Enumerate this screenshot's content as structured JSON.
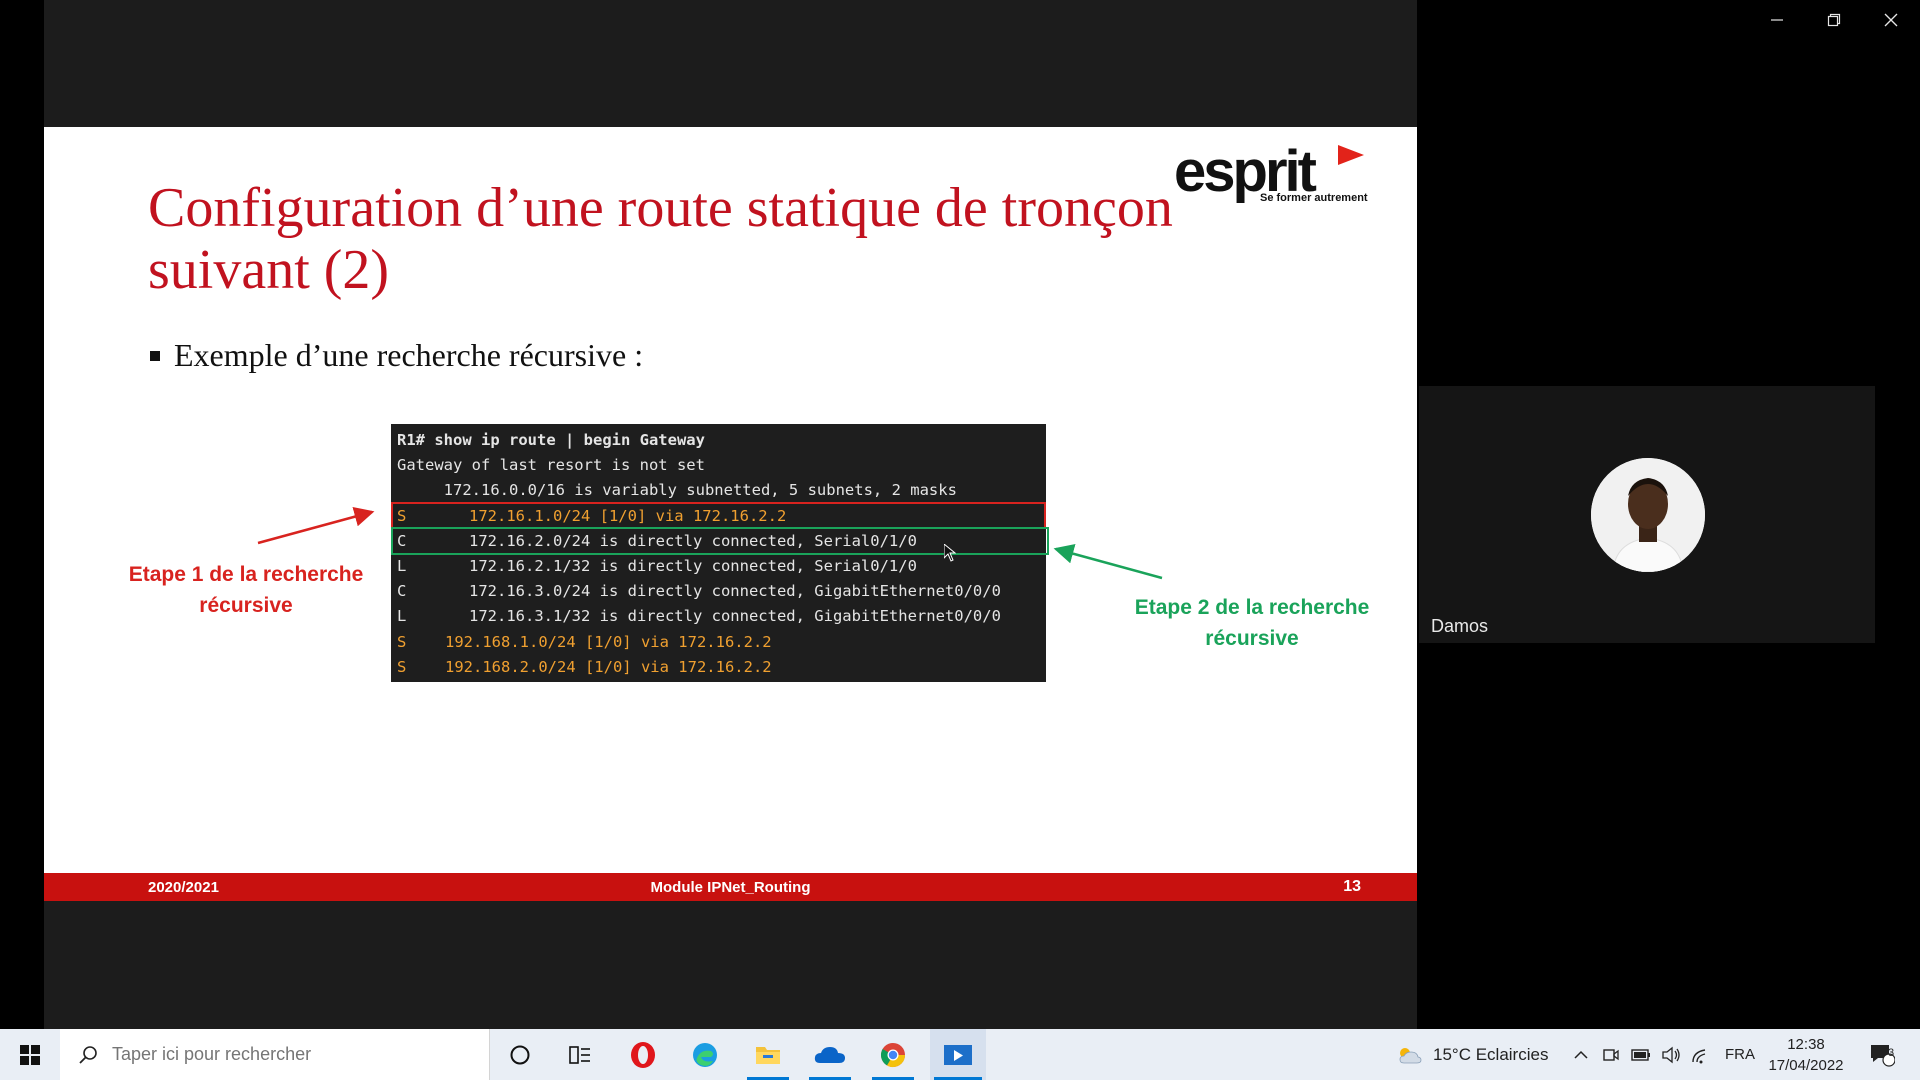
{
  "window": {
    "controls": [
      "minimize-icon",
      "restore-icon",
      "close-icon"
    ]
  },
  "slide": {
    "title_line1": "Configuration d’une route statique de tronçon",
    "title_line2": "suivant (2)",
    "logo_text": "esprit",
    "logo_tagline": "Se former autrement",
    "bullet": "Exemple d’une recherche récursive :",
    "terminal": {
      "prompt": "R1#",
      "command": "show ip route | begin Gateway",
      "lines": [
        {
          "code": "",
          "text": "Gateway of last resort is not set",
          "style": "normal",
          "indent": false
        },
        {
          "code": "",
          "text": "     172.16.0.0/16 is variably subnetted, 5 subnets, 2 masks",
          "style": "normal",
          "indent": false
        },
        {
          "code": "S",
          "text": "172.16.1.0/24 [1/0] via 172.16.2.2",
          "style": "static",
          "indent": true
        },
        {
          "code": "C",
          "text": "172.16.2.0/24 is directly connected, Serial0/1/0",
          "style": "normal",
          "indent": true
        },
        {
          "code": "L",
          "text": "172.16.2.1/32 is directly connected, Serial0/1/0",
          "style": "normal",
          "indent": true
        },
        {
          "code": "C",
          "text": "172.16.3.0/24 is directly connected, GigabitEthernet0/0/0",
          "style": "normal",
          "indent": true
        },
        {
          "code": "L",
          "text": "172.16.3.1/32 is directly connected, GigabitEthernet0/0/0",
          "style": "normal",
          "indent": true
        },
        {
          "code": "S",
          "text": "192.168.1.0/24 [1/0] via 172.16.2.2",
          "style": "static",
          "indent": false
        },
        {
          "code": "S",
          "text": "192.168.2.0/24 [1/0] via 172.16.2.2",
          "style": "static",
          "indent": false
        }
      ]
    },
    "step1_label": "Etape 1 de la recherche récursive",
    "step2_label": "Etape 2 de la recherche récursive",
    "footer": {
      "year": "2020/2021",
      "module": "Module IPNet_Routing",
      "page": "13"
    },
    "colors": {
      "title": "#c1121f",
      "footer": "#c8110f",
      "step1": "#d8231f",
      "step2": "#1aa35a",
      "static_route": "#f0a030"
    }
  },
  "participant": {
    "name": "Damos"
  },
  "taskbar": {
    "search_placeholder": "Taper ici pour rechercher",
    "apps": [
      "cortana-icon",
      "task-view-icon",
      "opera-icon",
      "edge-icon",
      "file-explorer-icon",
      "onedrive-icon",
      "chrome-icon",
      "media-app-icon"
    ],
    "weather": "15°C  Eclaircies",
    "language": "FRA",
    "time": "12:38",
    "date": "17/04/2022",
    "notifications": "3"
  }
}
